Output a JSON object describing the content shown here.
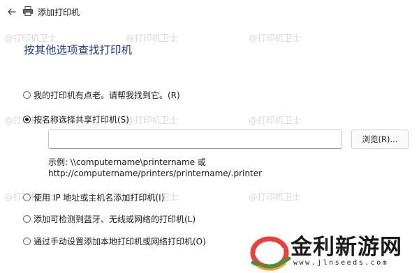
{
  "window": {
    "title": "添加打印机"
  },
  "page": {
    "heading": "按其他选项查找打印机"
  },
  "options": [
    {
      "label": "我的打印机有点老。请帮我找到它。(R)",
      "checked": false
    },
    {
      "label": "按名称选择共享打印机(S)",
      "checked": true
    },
    {
      "label": "使用 IP 地址或主机名添加打印机(I)",
      "checked": false
    },
    {
      "label": "添加可检测到蓝牙、无线或网络的打印机(L)",
      "checked": false
    },
    {
      "label": "通过手动设置添加本地打印机或网络打印机(O)",
      "checked": false
    }
  ],
  "shared_printer": {
    "value": "",
    "browse_label": "浏览(R)...",
    "example_line1": "示例: \\\\computername\\printername 或",
    "example_line2": "http://computername/printers/printername/.printer"
  },
  "watermark": {
    "text": "@打印机卫士"
  },
  "logo": {
    "name": "金利新游网",
    "url": "www.jlnseeds.com"
  },
  "icons": {
    "back": "back-arrow-icon",
    "printer": "printer-icon"
  }
}
